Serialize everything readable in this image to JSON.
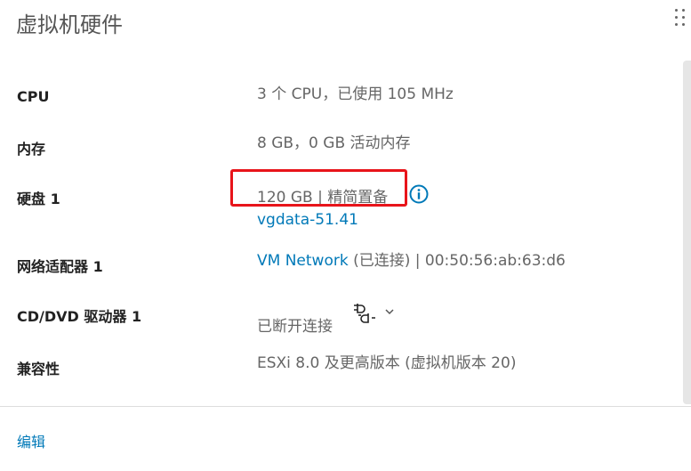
{
  "header": {
    "title": "虚拟机硬件"
  },
  "rows": {
    "cpu": {
      "label": "CPU",
      "value": "3 个 CPU，已使用 105 MHz"
    },
    "memory": {
      "label": "内存",
      "value": "8 GB，0 GB 活动内存"
    },
    "disk": {
      "label": "硬盘 1",
      "value": "120 GB | 精简置备",
      "datastore": "vgdata-51.41"
    },
    "network": {
      "label": "网络适配器 1",
      "network_name": "VM Network",
      "status": " (已连接) | 00:50:56:ab:63:d6"
    },
    "cdrom": {
      "label": "CD/DVD 驱动器 1",
      "value": "已断开连接"
    },
    "compat": {
      "label": "兼容性",
      "value": "ESXi 8.0 及更高版本 (虚拟机版本 20)"
    }
  },
  "footer": {
    "edit_label": "编辑"
  },
  "colors": {
    "link": "#0079b8",
    "highlight": "#e8141a",
    "label": "#222222",
    "value": "#666666"
  },
  "icons": {
    "info": "info-circle-icon",
    "plug": "disconnected-plug-icon",
    "chevron": "chevron-down-icon",
    "drag": "drag-handle-icon"
  }
}
